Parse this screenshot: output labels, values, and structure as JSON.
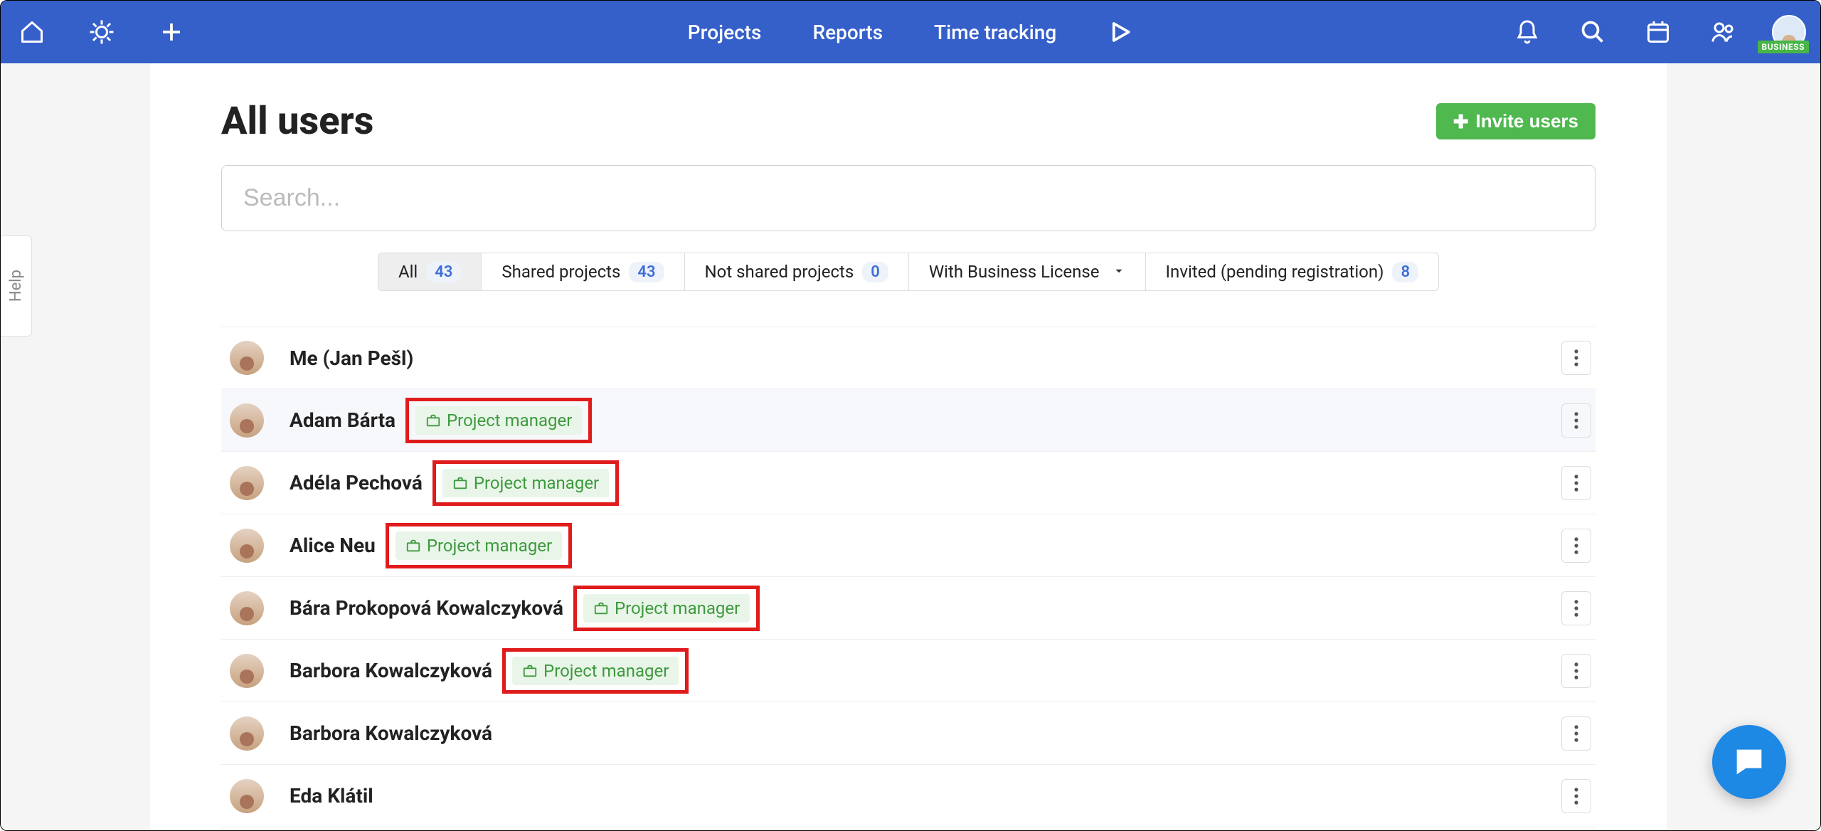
{
  "topnav": {
    "links": [
      "Projects",
      "Reports",
      "Time tracking"
    ]
  },
  "account_tag": "BUSINESS",
  "page": {
    "title": "All users",
    "invite_label": "Invite users"
  },
  "search": {
    "placeholder": "Search..."
  },
  "tabs": [
    {
      "label": "All",
      "count": "43",
      "active": true
    },
    {
      "label": "Shared projects",
      "count": "43"
    },
    {
      "label": "Not shared projects",
      "count": "0"
    },
    {
      "label": "With Business License",
      "caret": true
    },
    {
      "label": "Invited (pending registration)",
      "count": "8"
    }
  ],
  "role_label": "Project manager",
  "users": [
    {
      "name": "Me (Jan Pešl)",
      "role": false,
      "highlight": false
    },
    {
      "name": "Adam Bárta",
      "role": true,
      "highlight": true,
      "hover": true
    },
    {
      "name": "Adéla Pechová",
      "role": true,
      "highlight": true
    },
    {
      "name": "Alice Neu",
      "role": true,
      "highlight": true
    },
    {
      "name": "Bára Prokopová Kowalczyková",
      "role": true,
      "highlight": true
    },
    {
      "name": "Barbora Kowalczyková",
      "role": true,
      "highlight": true
    },
    {
      "name": "Barbora Kowalczyková",
      "role": false,
      "highlight": false
    },
    {
      "name": "Eda Klátil",
      "role": false,
      "highlight": false
    }
  ],
  "help_label": "Help"
}
